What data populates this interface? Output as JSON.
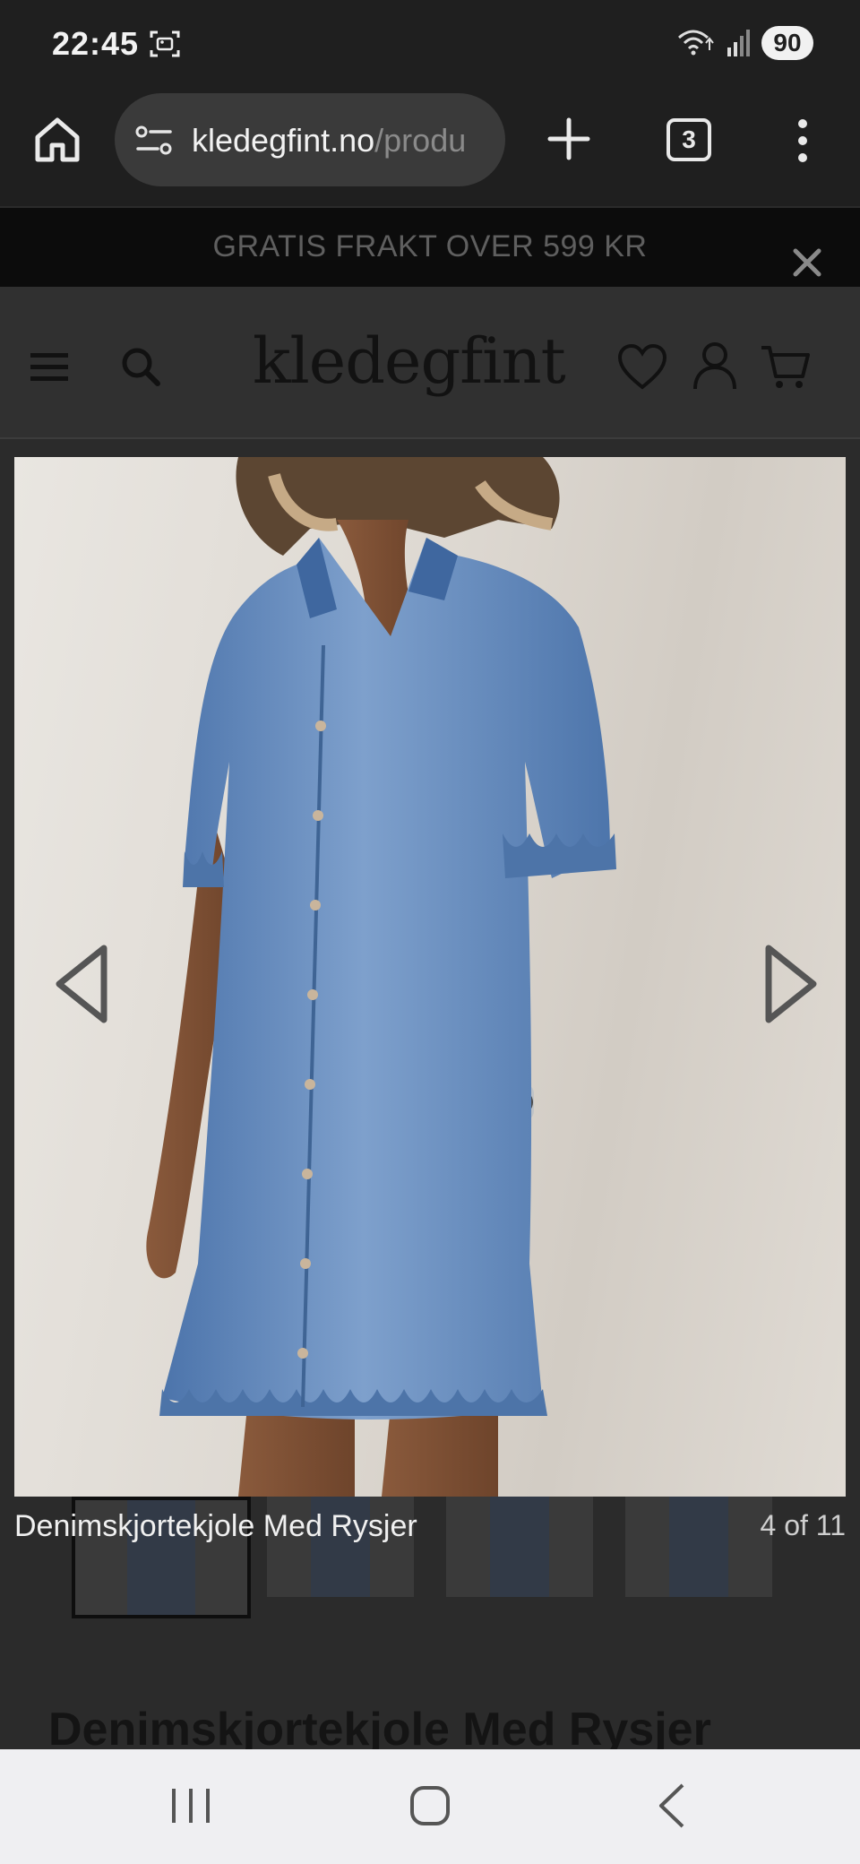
{
  "status_bar": {
    "time": "22:45",
    "battery": "90",
    "icons": [
      "screenshot-icon",
      "wifi-icon",
      "signal-icon",
      "battery-icon"
    ]
  },
  "browser": {
    "url_domain": "kledegfint.no",
    "url_path": "/produ",
    "tab_count": "3",
    "icons": [
      "home-icon",
      "site-settings-icon",
      "plus-icon",
      "tab-switcher-icon",
      "more-vert-icon"
    ]
  },
  "promo": {
    "text": "GRATIS FRAKT OVER 599 KR",
    "close_icon": "close-icon"
  },
  "site_header": {
    "logo": "kledegfint",
    "icons": [
      "menu-icon",
      "search-icon",
      "heart-icon",
      "user-icon",
      "cart-icon"
    ]
  },
  "gallery": {
    "caption": "Denimskjortekjole Med Rysjer",
    "counter": "4 of 11",
    "current_index": 4,
    "total": 11,
    "thumbnail_count": 4,
    "active_thumbnail": 1
  },
  "product": {
    "title": "Denimskjortekjole Med Rysjer"
  },
  "colors": {
    "page_bg": "#2b2b2b",
    "chrome_bg": "#1f1f1f",
    "promo_bg": "#0c0c0c",
    "denim": "#5f87bd",
    "nav_bar": "#efeff2"
  }
}
